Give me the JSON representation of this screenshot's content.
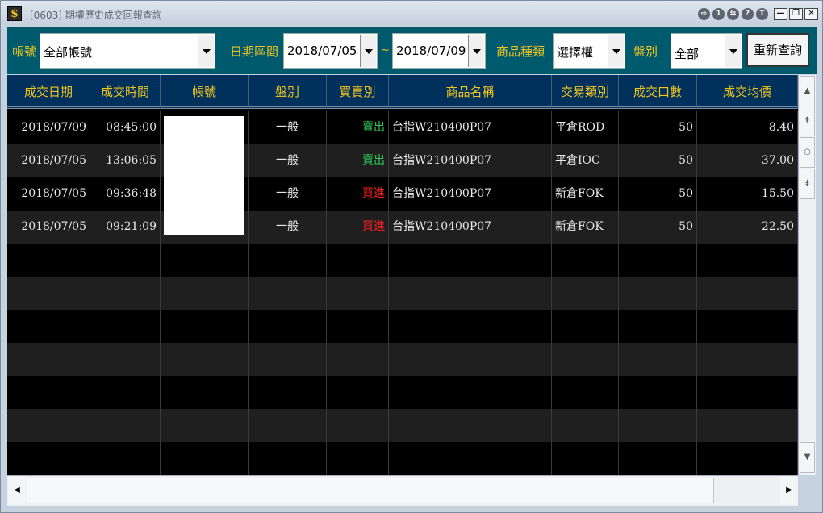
{
  "window": {
    "icon": "$",
    "title": "[0603] 期權歷史成交回報查詢",
    "title_buttons": [
      "⇨",
      "1",
      "⇆",
      "?",
      "T"
    ],
    "window_buttons": [
      "—",
      "❐",
      "✕"
    ]
  },
  "toolbar": {
    "account_label": "帳號",
    "account_value": "全部帳號",
    "date_label": "日期區間",
    "date_from": "2018/07/05",
    "date_sep": "~",
    "date_to": "2018/07/09",
    "product_type_label": "商品種類",
    "product_type_value": "選擇權",
    "session_label": "盤別",
    "session_value": "全部",
    "requery_label": "重新查詢"
  },
  "table": {
    "headers": [
      "成交日期",
      "成交時間",
      "帳號",
      "盤別",
      "買賣別",
      "商品名稱",
      "交易類別",
      "成交口數",
      "成交均價"
    ],
    "rows": [
      {
        "date": "2018/07/09",
        "time": "08:45:00",
        "account": "",
        "session": "一般",
        "side": "賣出",
        "product": "台指W210400P07",
        "trade_type": "平倉ROD",
        "qty": "50",
        "avg_price": "8.40"
      },
      {
        "date": "2018/07/05",
        "time": "13:06:05",
        "account": "",
        "session": "一般",
        "side": "賣出",
        "product": "台指W210400P07",
        "trade_type": "平倉IOC",
        "qty": "50",
        "avg_price": "37.00"
      },
      {
        "date": "2018/07/05",
        "time": "09:36:48",
        "account": "",
        "session": "一般",
        "side": "買進",
        "product": "台指W210400P07",
        "trade_type": "新倉FOK",
        "qty": "50",
        "avg_price": "15.50"
      },
      {
        "date": "2018/07/05",
        "time": "09:21:09",
        "account": "",
        "session": "一般",
        "side": "買進",
        "product": "台指W210400P07",
        "trade_type": "新倉FOK",
        "qty": "50",
        "avg_price": "22.50"
      }
    ]
  },
  "colors": {
    "toolbar_bg": "#005a6e",
    "header_bg": "#00305c",
    "label_gold": "#f3c51e",
    "sell_green": "#2ecc55",
    "buy_red": "#ff2020"
  },
  "icons": {
    "scroll_up": "scroll-up-icon",
    "scroll_down": "scroll-down-icon",
    "scroll_left": "scroll-left-icon",
    "scroll_right": "scroll-right-icon",
    "page_up": "page-up-icon",
    "page_down": "page-down-icon",
    "scroll_center": "scroll-center-icon"
  }
}
